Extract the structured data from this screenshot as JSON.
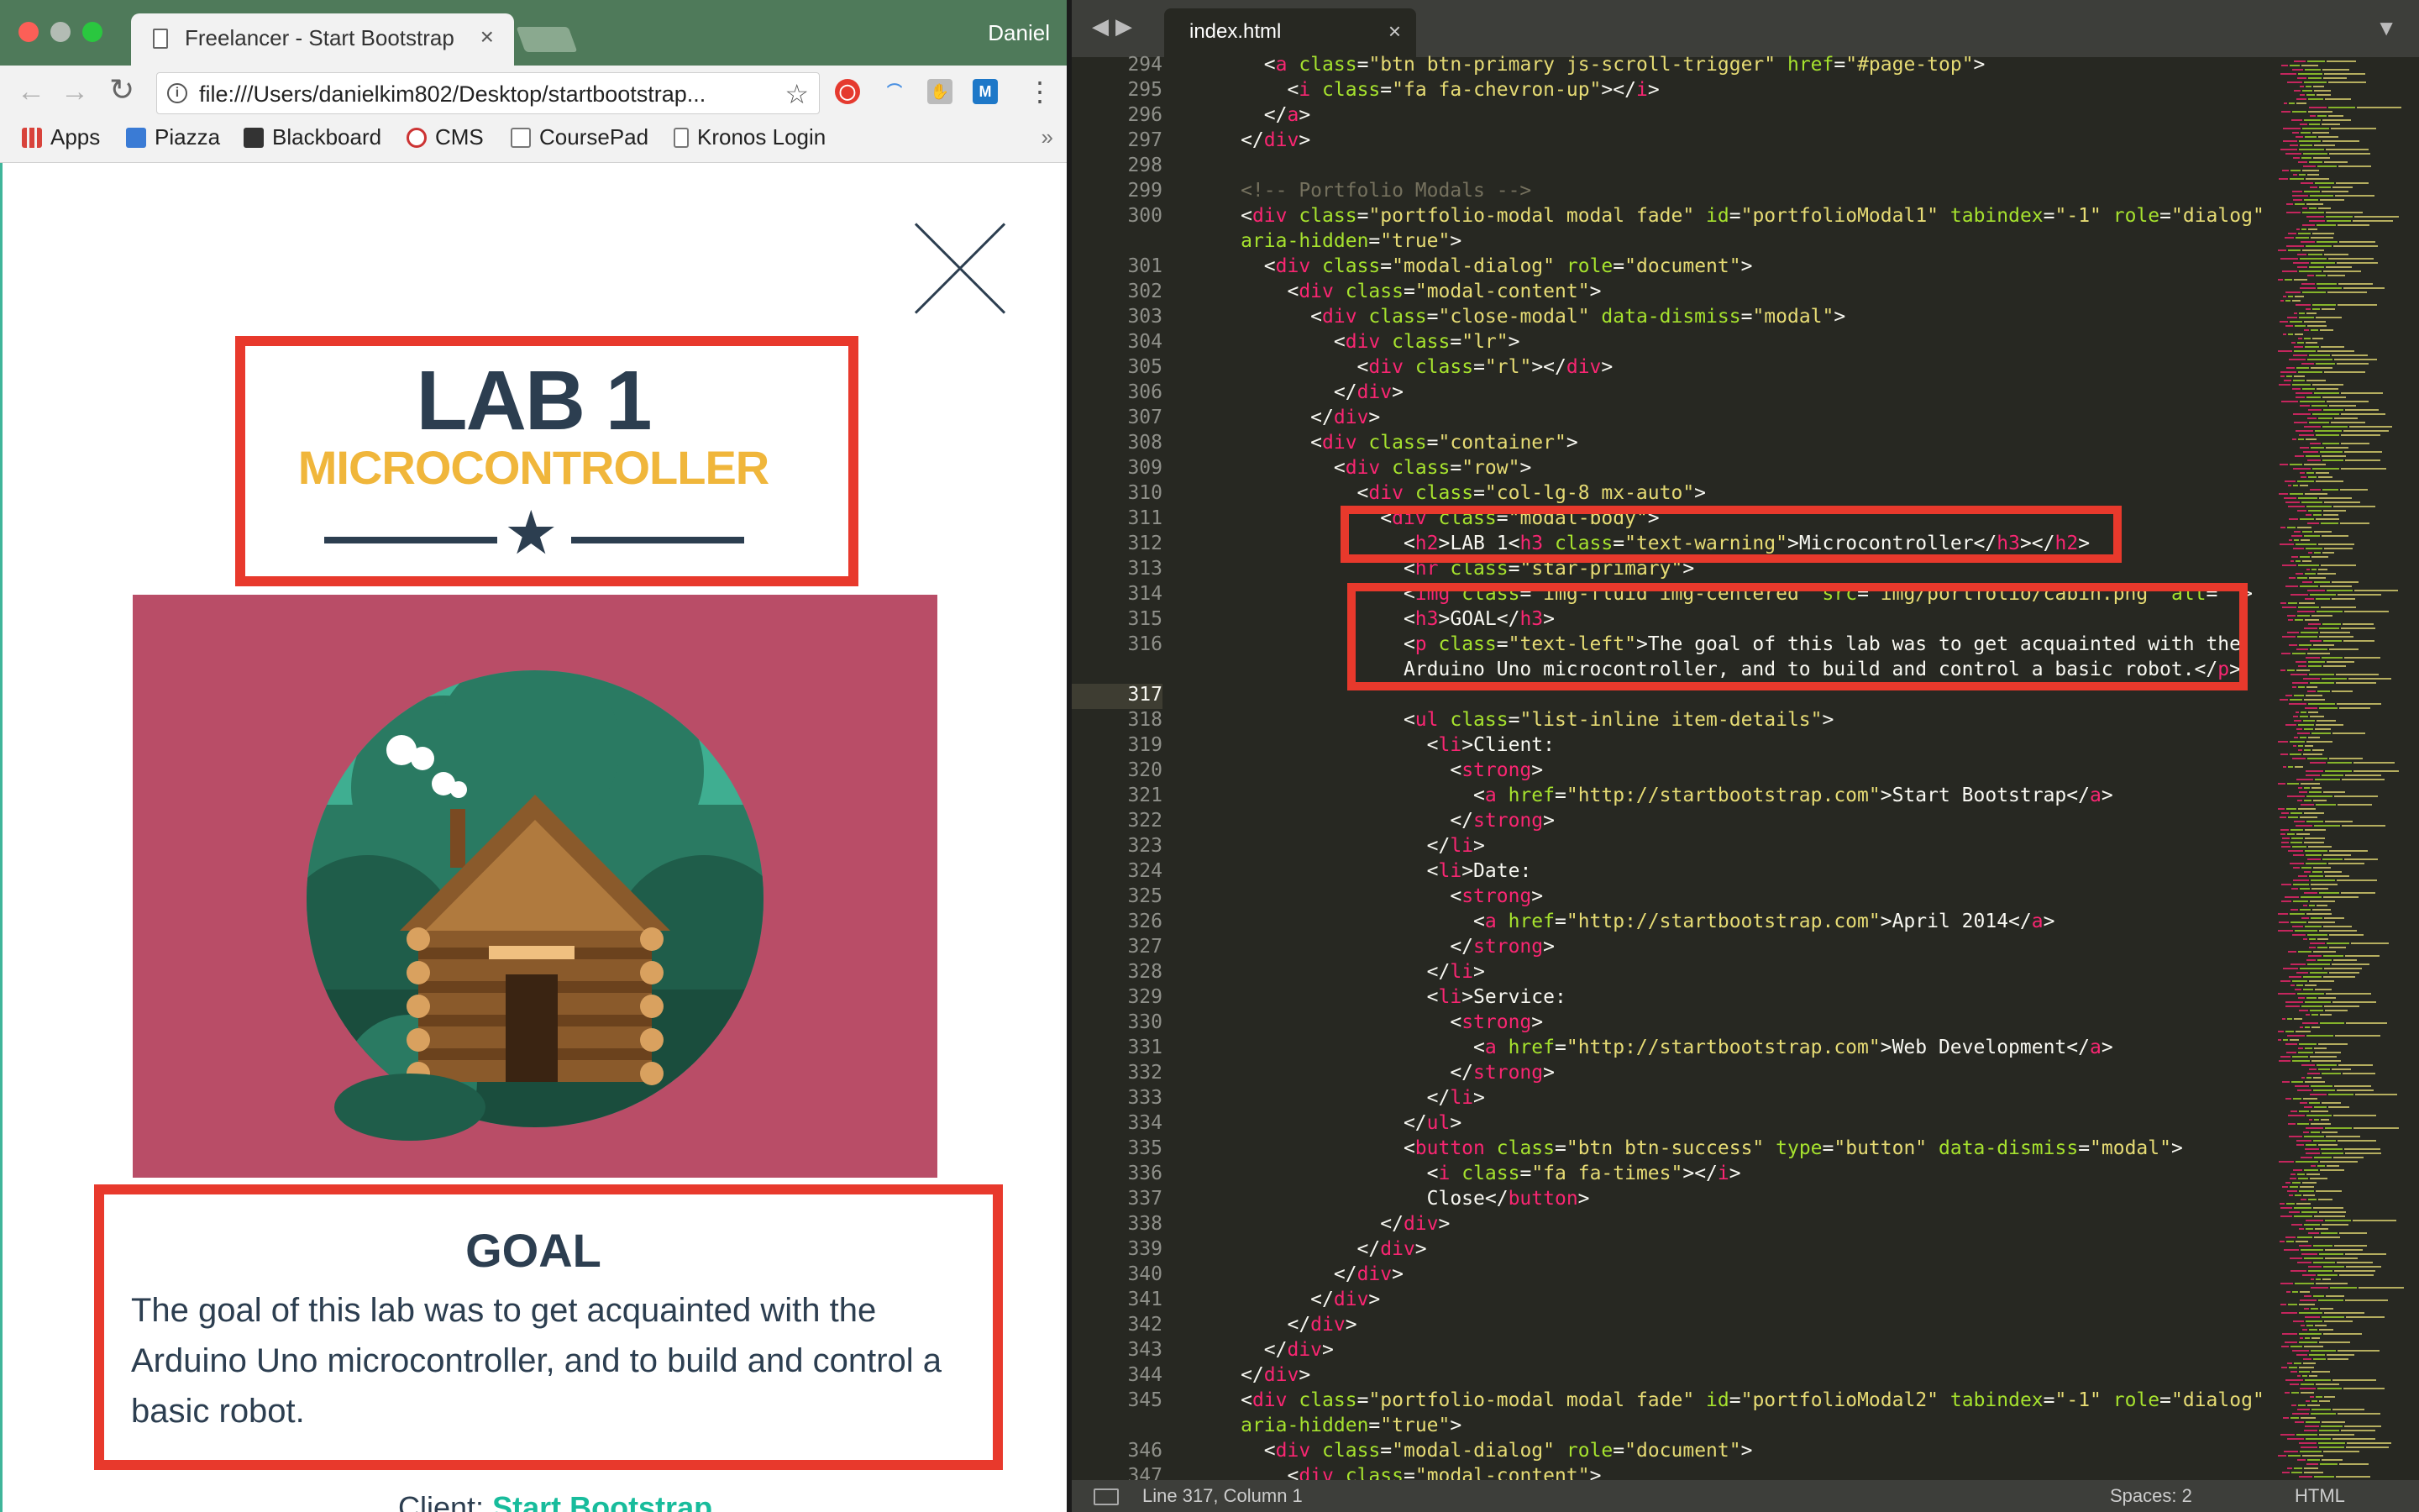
{
  "browser": {
    "tab_title": "Freelancer - Start Bootstrap Th",
    "profile_name": "Daniel",
    "url": "file:///Users/danielkim802/Desktop/startbootstrap...",
    "bookmarks": [
      "Apps",
      "Piazza",
      "Blackboard",
      "CMS",
      "CoursePad",
      "Kronos Login"
    ],
    "bookmarks_overflow": "»"
  },
  "page": {
    "title": "LAB 1",
    "subtitle": "MICROCONTROLLER",
    "goal_heading": "GOAL",
    "goal_text": "The goal of this lab was to get acquainted with the Arduino Uno microcontroller, and to build and control a basic robot.",
    "client_label": "Client:",
    "client_link": "Start Bootstrap",
    "colors": {
      "title": "#2c3e50",
      "subtitle": "#f0b63b",
      "highlight": "#e8392c",
      "image_bg": "#b94d67",
      "link": "#18bc9c"
    }
  },
  "editor": {
    "tab_filename": "index.html",
    "status_position": "Line 317, Column 1",
    "status_spaces": "Spaces: 2",
    "status_syntax": "HTML",
    "current_line": "317",
    "lines": [
      {
        "n": "294",
        "code": "        <a class=\"btn btn-primary js-scroll-trigger\" href=\"#page-top\">"
      },
      {
        "n": "295",
        "code": "          <i class=\"fa fa-chevron-up\"></i>"
      },
      {
        "n": "296",
        "code": "        </a>"
      },
      {
        "n": "297",
        "code": "      </div>"
      },
      {
        "n": "298",
        "code": ""
      },
      {
        "n": "299",
        "code": "      <!-- Portfolio Modals -->"
      },
      {
        "n": "300",
        "code": "      <div class=\"portfolio-modal modal fade\" id=\"portfolioModal1\" tabindex=\"-1\" role=\"dialog\""
      },
      {
        "n": "",
        "code": "      aria-hidden=\"true\">"
      },
      {
        "n": "301",
        "code": "        <div class=\"modal-dialog\" role=\"document\">"
      },
      {
        "n": "302",
        "code": "          <div class=\"modal-content\">"
      },
      {
        "n": "303",
        "code": "            <div class=\"close-modal\" data-dismiss=\"modal\">"
      },
      {
        "n": "304",
        "code": "              <div class=\"lr\">"
      },
      {
        "n": "305",
        "code": "                <div class=\"rl\"></div>"
      },
      {
        "n": "306",
        "code": "              </div>"
      },
      {
        "n": "307",
        "code": "            </div>"
      },
      {
        "n": "308",
        "code": "            <div class=\"container\">"
      },
      {
        "n": "309",
        "code": "              <div class=\"row\">"
      },
      {
        "n": "310",
        "code": "                <div class=\"col-lg-8 mx-auto\">"
      },
      {
        "n": "311",
        "code": "                  <div class=\"modal-body\">"
      },
      {
        "n": "312",
        "code": "                    <h2>LAB 1<h3 class=\"text-warning\">Microcontroller</h3></h2>"
      },
      {
        "n": "313",
        "code": "                    <hr class=\"star-primary\">"
      },
      {
        "n": "314",
        "code": "                    <img class=\"img-fluid img-centered\" src=\"img/portfolio/cabin.png\" alt=\"\">"
      },
      {
        "n": "315",
        "code": "                    <h3>GOAL</h3>"
      },
      {
        "n": "316",
        "code": "                    <p class=\"text-left\">The goal of this lab was to get acquainted with the"
      },
      {
        "n": "",
        "code": "                    Arduino Uno microcontroller, and to build and control a basic robot.</p>"
      },
      {
        "n": "317",
        "code": ""
      },
      {
        "n": "318",
        "code": "                    <ul class=\"list-inline item-details\">"
      },
      {
        "n": "319",
        "code": "                      <li>Client:"
      },
      {
        "n": "320",
        "code": "                        <strong>"
      },
      {
        "n": "321",
        "code": "                          <a href=\"http://startbootstrap.com\">Start Bootstrap</a>"
      },
      {
        "n": "322",
        "code": "                        </strong>"
      },
      {
        "n": "323",
        "code": "                      </li>"
      },
      {
        "n": "324",
        "code": "                      <li>Date:"
      },
      {
        "n": "325",
        "code": "                        <strong>"
      },
      {
        "n": "326",
        "code": "                          <a href=\"http://startbootstrap.com\">April 2014</a>"
      },
      {
        "n": "327",
        "code": "                        </strong>"
      },
      {
        "n": "328",
        "code": "                      </li>"
      },
      {
        "n": "329",
        "code": "                      <li>Service:"
      },
      {
        "n": "330",
        "code": "                        <strong>"
      },
      {
        "n": "331",
        "code": "                          <a href=\"http://startbootstrap.com\">Web Development</a>"
      },
      {
        "n": "332",
        "code": "                        </strong>"
      },
      {
        "n": "333",
        "code": "                      </li>"
      },
      {
        "n": "334",
        "code": "                    </ul>"
      },
      {
        "n": "335",
        "code": "                    <button class=\"btn btn-success\" type=\"button\" data-dismiss=\"modal\">"
      },
      {
        "n": "336",
        "code": "                      <i class=\"fa fa-times\"></i>"
      },
      {
        "n": "337",
        "code": "                      Close</button>"
      },
      {
        "n": "338",
        "code": "                  </div>"
      },
      {
        "n": "339",
        "code": "                </div>"
      },
      {
        "n": "340",
        "code": "              </div>"
      },
      {
        "n": "341",
        "code": "            </div>"
      },
      {
        "n": "342",
        "code": "          </div>"
      },
      {
        "n": "343",
        "code": "        </div>"
      },
      {
        "n": "344",
        "code": "      </div>"
      },
      {
        "n": "345",
        "code": "      <div class=\"portfolio-modal modal fade\" id=\"portfolioModal2\" tabindex=\"-1\" role=\"dialog\""
      },
      {
        "n": "",
        "code": "      aria-hidden=\"true\">"
      },
      {
        "n": "346",
        "code": "        <div class=\"modal-dialog\" role=\"document\">"
      },
      {
        "n": "347",
        "code": "          <div class=\"modal-content\">"
      }
    ]
  }
}
